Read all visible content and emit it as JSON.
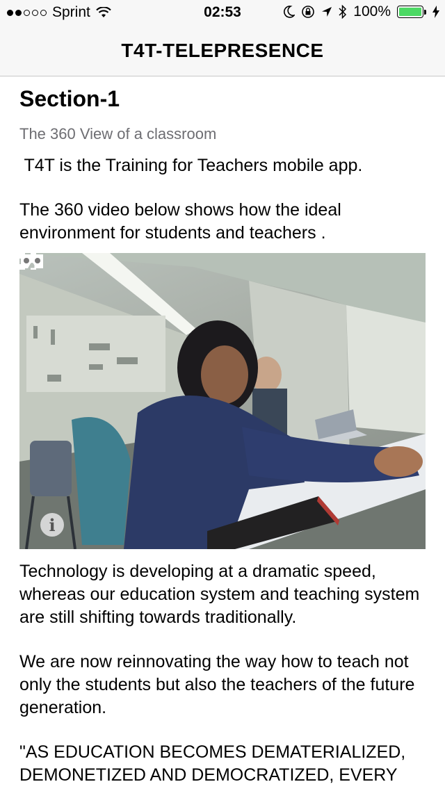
{
  "status_bar": {
    "carrier": "Sprint",
    "time": "02:53",
    "battery": "100%",
    "battery_level": 1.0,
    "battery_color": "#4cd964",
    "icons": [
      "signal-dots-icon",
      "wifi-icon",
      "moon-icon",
      "rotation-lock-icon",
      "location-icon",
      "bluetooth-icon",
      "battery-icon",
      "charging-icon"
    ]
  },
  "nav": {
    "title": "T4T-TELEPRESENCE"
  },
  "content": {
    "section_title": "Section-1",
    "subtitle": "The 360 View of a classroom",
    "paragraphs": [
      " T4T is the Training for Teachers mobile app.",
      "The 360 video below shows how the ideal environment for students and teachers .",
      "Technology is developing at a dramatic speed, whereas our education system and teaching system are still shifting towards traditionally.",
      "We are now reinnovating the way how to teach not only the students but also the teachers of the future generation.",
      "\"AS EDUCATION BECOMES DEMATERIALIZED, DEMONETIZED AND DEMOCRATIZED, EVERY MAN, WOMAN AND CHILD ON THE PLANET"
    ]
  },
  "video": {
    "controls": [
      "info-icon",
      "cardboard-vr-icon",
      "fullscreen-icon"
    ]
  }
}
